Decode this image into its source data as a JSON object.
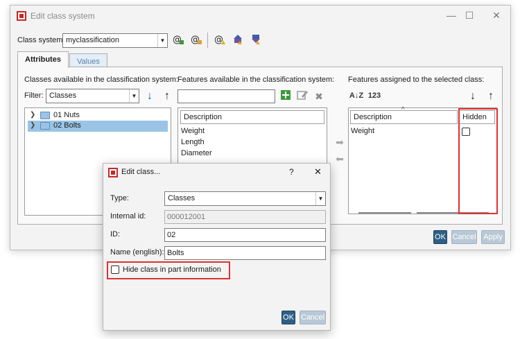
{
  "window": {
    "title": "Edit class system",
    "controls": {
      "minimize": "—",
      "maximize": "☐",
      "close": "✕"
    }
  },
  "class_system": {
    "label": "Class system:",
    "value": "myclassification",
    "icons": [
      "add-at-icon",
      "edit-at-icon",
      "at-warning-icon",
      "export-icon",
      "import-icon"
    ]
  },
  "tabs": [
    {
      "label": "Attributes",
      "active": true
    },
    {
      "label": "Values",
      "active": false
    }
  ],
  "classes_panel": {
    "heading": "Classes available in the classification system:",
    "filter_label": "Filter:",
    "filter_value": "Classes",
    "sort_down": "↓",
    "sort_up": "↑",
    "items": [
      {
        "label": "01 Nuts",
        "selected": false
      },
      {
        "label": "02 Bolts",
        "selected": true
      }
    ]
  },
  "features_panel": {
    "heading": "Features available in the classification system:",
    "search_value": "",
    "column": "Description",
    "items": [
      "Weight",
      "Length",
      "Diameter"
    ]
  },
  "assigned_panel": {
    "heading": "Features assigned to the selected class:",
    "sort_az": "A↓Z",
    "sort_num": "123",
    "sort_down": "↓",
    "sort_up": "↑",
    "col_description": "Description",
    "col_hidden": "Hidden",
    "sort_indicator": "^",
    "rows": [
      {
        "description": "Weight",
        "hidden": false
      }
    ]
  },
  "transfer": {
    "right": "➡",
    "left": "⬅"
  },
  "main_buttons": {
    "ok": "OK",
    "cancel": "Cancel",
    "apply": "Apply"
  },
  "dialog": {
    "title": "Edit class...",
    "help": "?",
    "close": "✕",
    "type_label": "Type:",
    "type_value": "Classes",
    "internal_id_label": "Internal id:",
    "internal_id_value": "000012001",
    "id_label": "ID:",
    "id_value": "02",
    "name_label": "Name (english):",
    "name_value": "Bolts",
    "hide_label": "Hide class in part information",
    "hide_checked": false,
    "ok": "OK",
    "cancel": "Cancel"
  },
  "colors": {
    "highlight": "#e03030",
    "selection": "#99c4e6",
    "ok_button": "#2e5f86"
  }
}
